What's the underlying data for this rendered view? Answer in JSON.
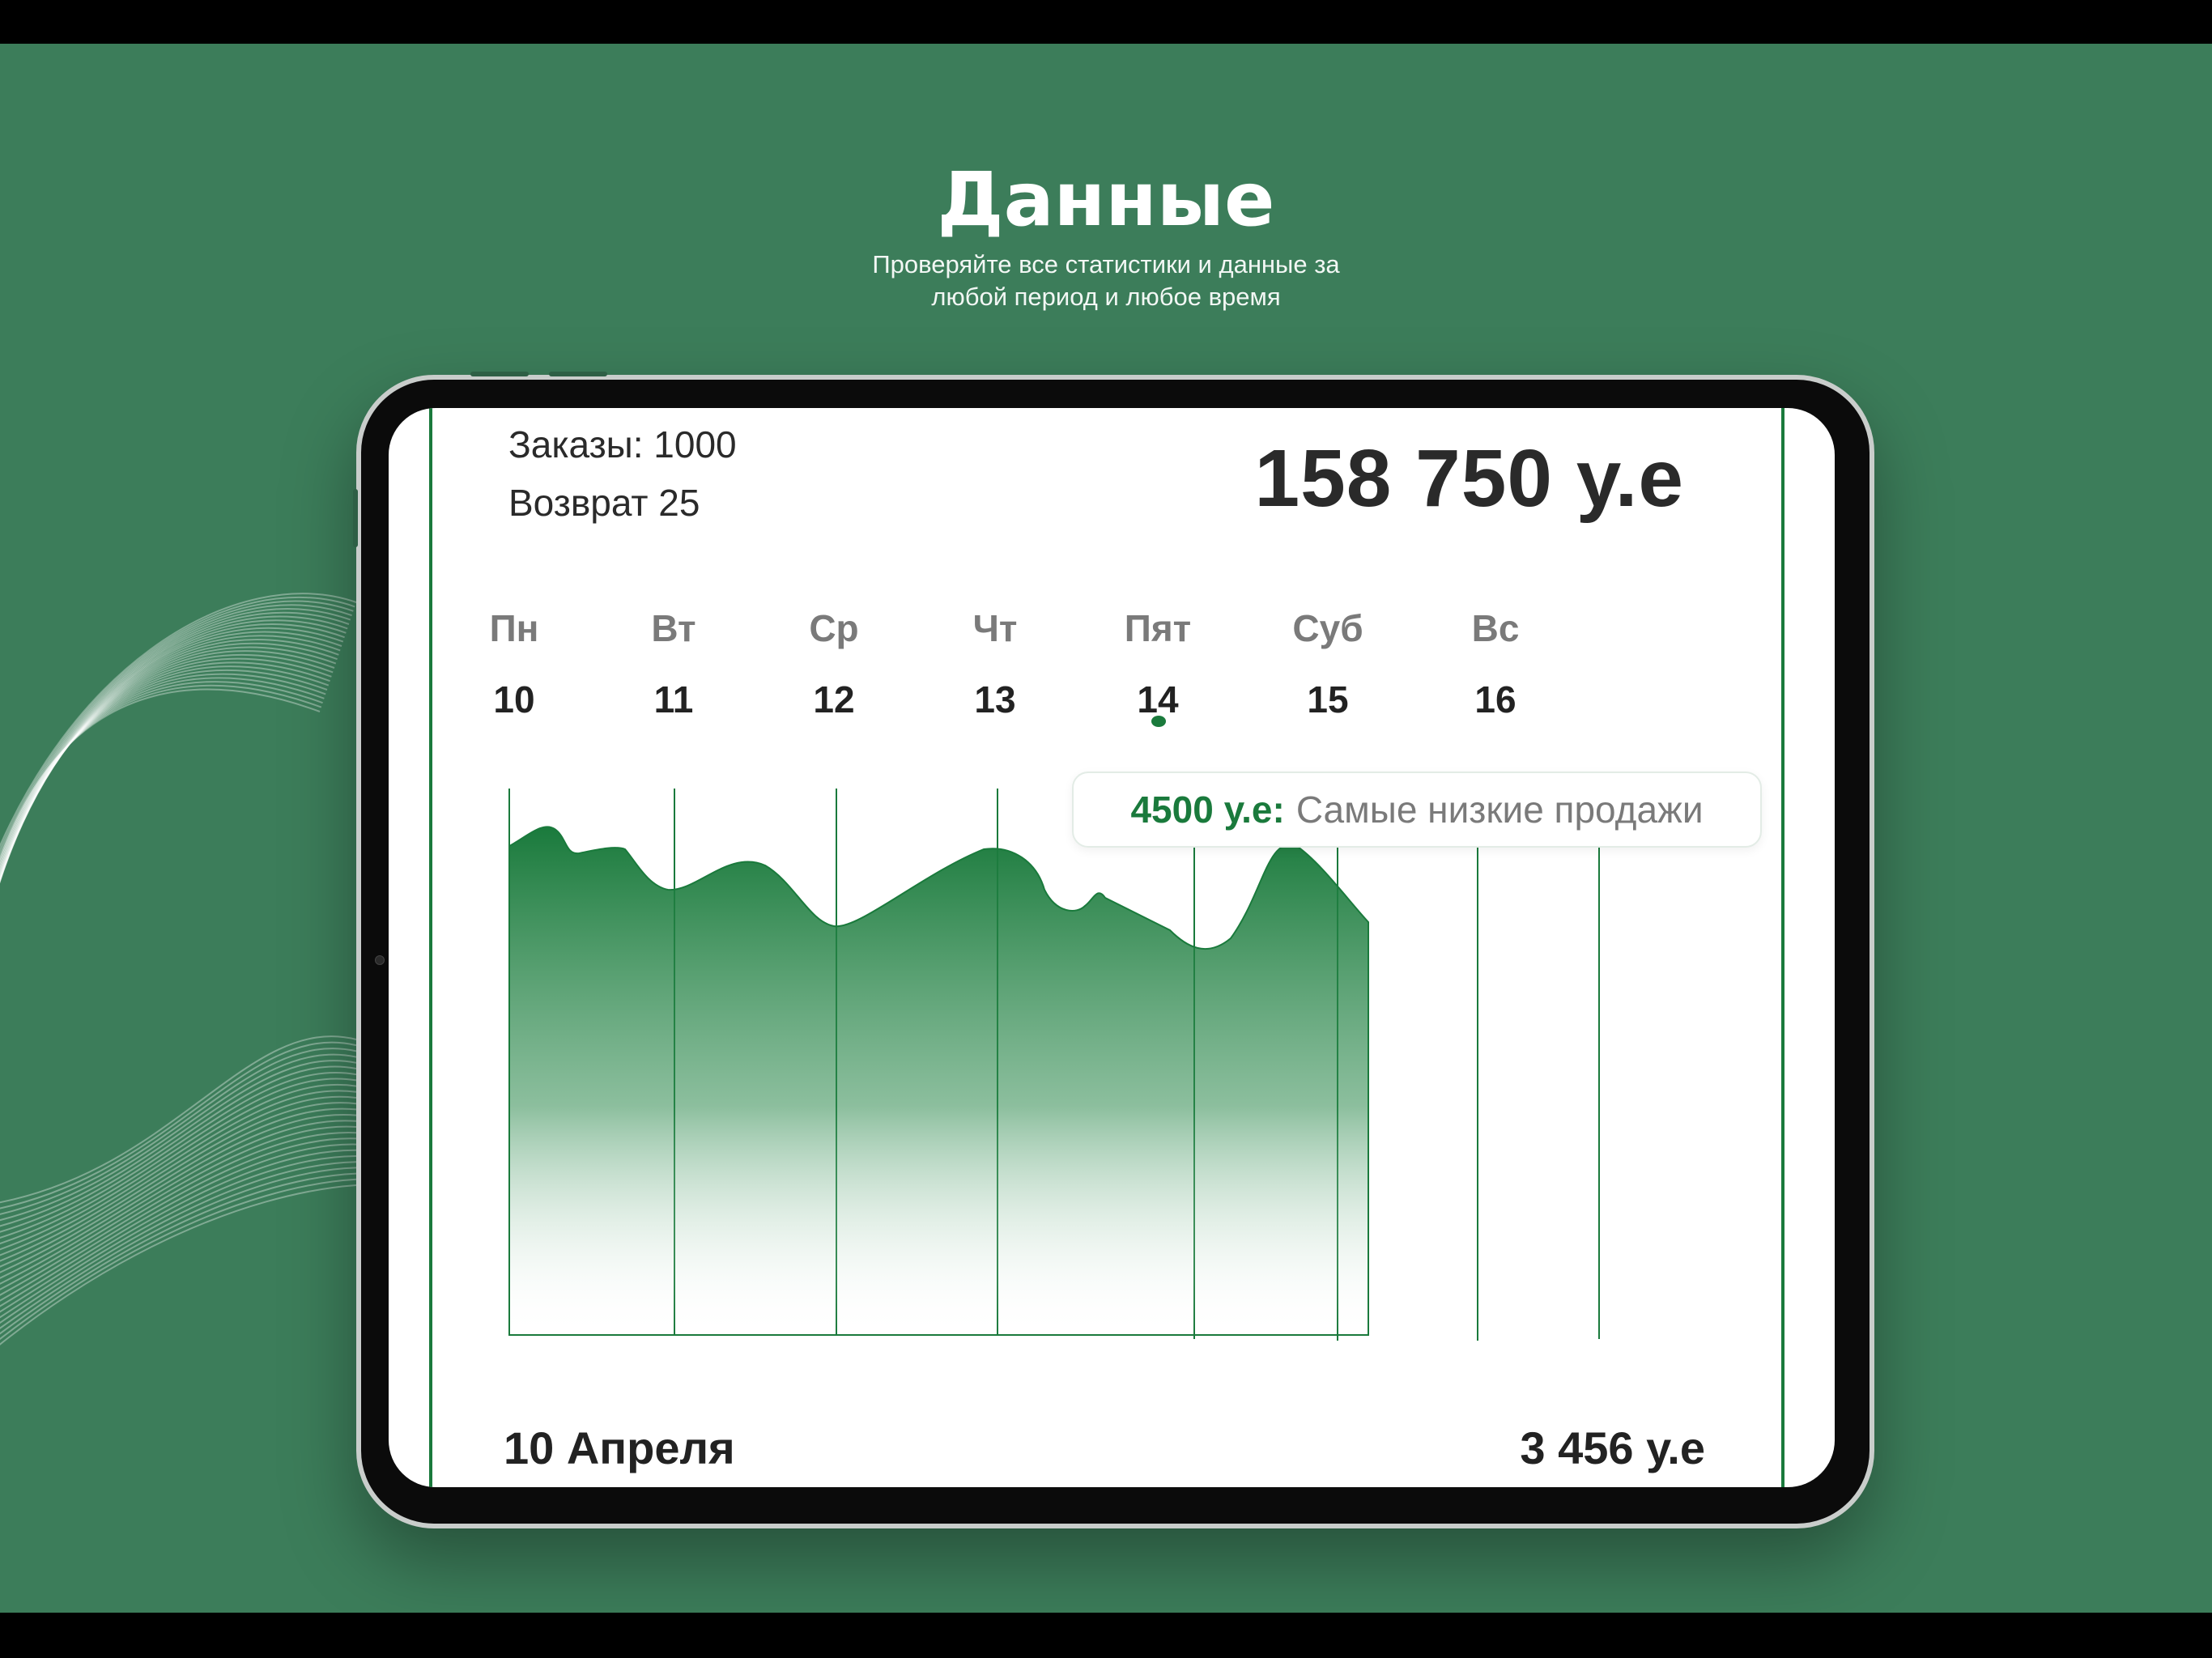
{
  "promo": {
    "title": "Данные",
    "subtitle_line1": "Проверяйте все статистики и данные за",
    "subtitle_line2": "любой период и любое время"
  },
  "stats": {
    "orders_text": "Заказы: 1000",
    "returns_text": "Возврат 25",
    "total": "158 750 у.е"
  },
  "week": [
    {
      "name": "Пн",
      "date": "10"
    },
    {
      "name": "Вт",
      "date": "11"
    },
    {
      "name": "Ср",
      "date": "12"
    },
    {
      "name": "Чт",
      "date": "13"
    },
    {
      "name": "Пят",
      "date": "14",
      "selected": true
    },
    {
      "name": "Суб",
      "date": "15"
    },
    {
      "name": "Вс",
      "date": "16"
    }
  ],
  "tooltip": {
    "value": "4500 у.е:",
    "text": "Самые низкие продажи"
  },
  "footer": {
    "date": "10 Апреля",
    "value": "3 456 у.е"
  },
  "colors": {
    "background": "#3c7d5a",
    "accent": "#1a7a3c",
    "muted_text": "#7a7a7a"
  }
}
